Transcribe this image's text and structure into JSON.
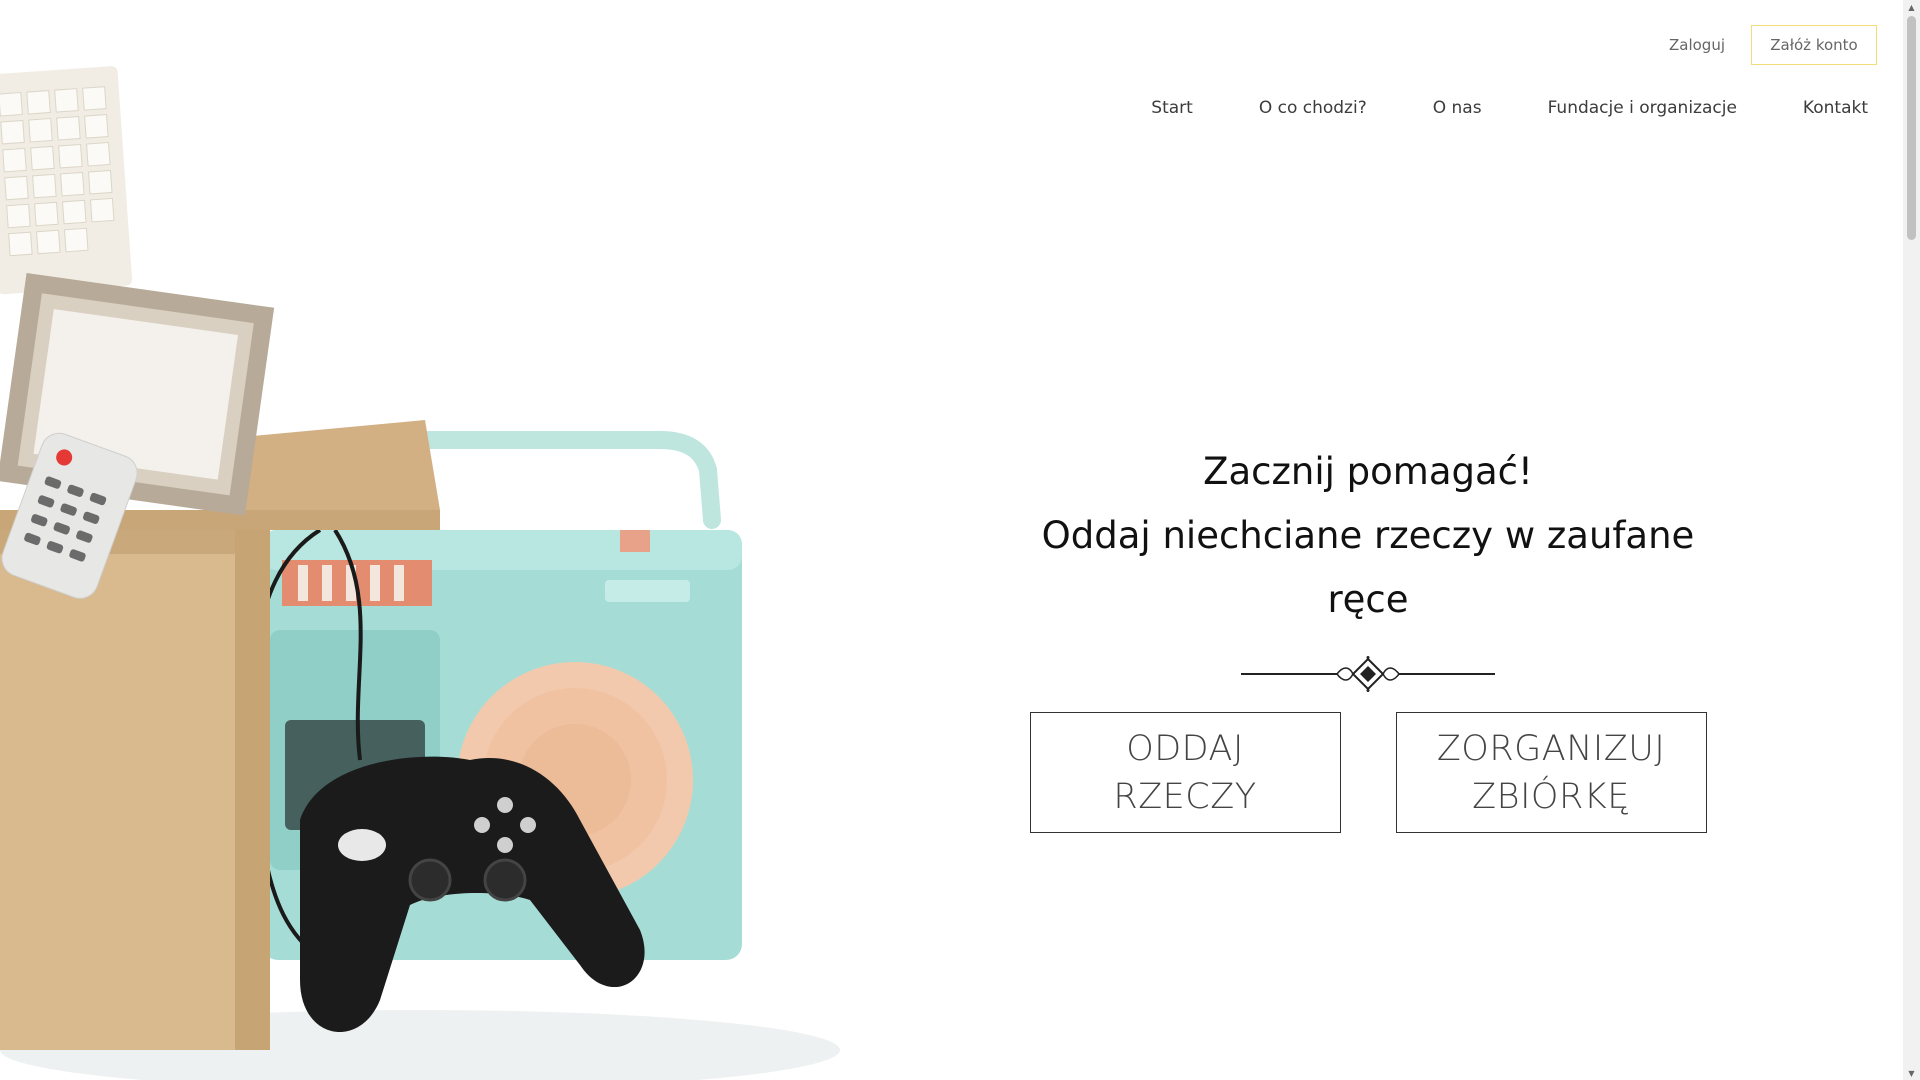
{
  "auth": {
    "login_label": "Zaloguj",
    "register_label": "Załóż konto",
    "register_border_color": "#f2dd78"
  },
  "nav": {
    "items": [
      {
        "label": "Start"
      },
      {
        "label": "O co chodzi?"
      },
      {
        "label": "O nas"
      },
      {
        "label": "Fundacje i organizacje"
      },
      {
        "label": "Kontakt"
      }
    ]
  },
  "hero": {
    "title_line1": "Zacznij pomagać!",
    "title_line2": "Oddaj niechciane rzeczy w zaufane ręce",
    "cta_give": {
      "line1": "ODDAJ",
      "line2": "RZECZY"
    },
    "cta_organize": {
      "line1": "ZORGANIZUJ",
      "line2": "ZBIÓRKĘ"
    },
    "image_icon": "donated-items-box-illustration",
    "ornament_icon": "decorative-divider-icon"
  },
  "colors": {
    "box": "#d9b98e",
    "radio": "#a5ddd6",
    "speaker": "#f2c9ac",
    "gamepad": "#1b1b1b"
  }
}
